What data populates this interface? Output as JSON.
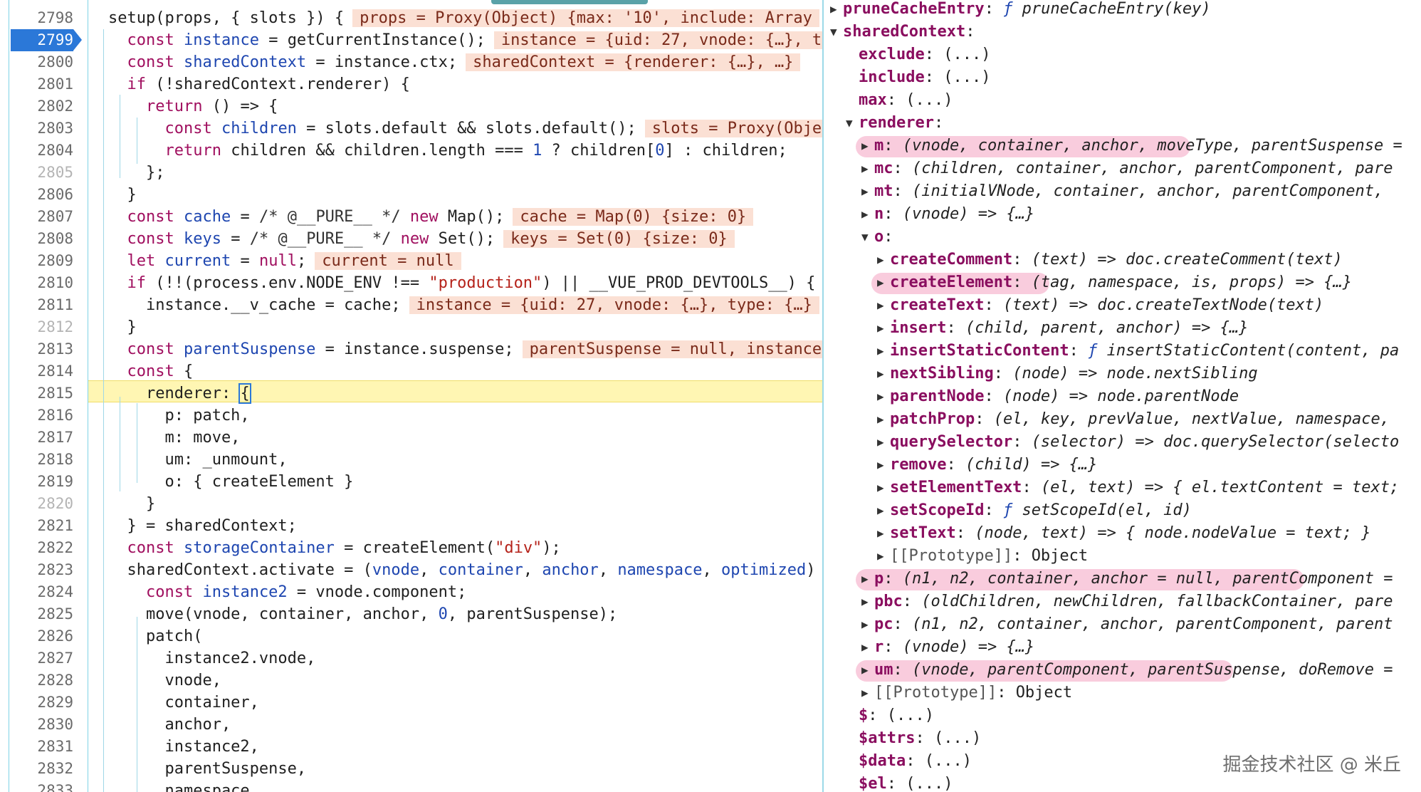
{
  "editor": {
    "lines": [
      {
        "no": "2798",
        "code": "setup(props, { slots }) {",
        "inline": "props = Proxy(Object) {max: '10', include: Array"
      },
      {
        "no": "2799",
        "code": "  const instance = getCurrentInstance();",
        "inline": "instance = {uid: 27, vnode: {…}, t"
      },
      {
        "no": "2800",
        "code": "  const sharedContext = instance.ctx;",
        "inline": "sharedContext = {renderer: {…}, …}"
      },
      {
        "no": "2801",
        "code": "  if (!sharedContext.renderer) {",
        "inline": ""
      },
      {
        "no": "2802",
        "code": "    return () => {",
        "inline": ""
      },
      {
        "no": "2803",
        "code": "      const children = slots.default && slots.default();",
        "inline": "slots = Proxy(Obje"
      },
      {
        "no": "2804",
        "code": "      return children && children.length === 1 ? children[0] : children;",
        "inline": ""
      },
      {
        "no": "2805",
        "code": "    };",
        "inline": ""
      },
      {
        "no": "2806",
        "code": "  }",
        "inline": ""
      },
      {
        "no": "2807",
        "code": "  const cache = /* @__PURE__ */ new Map();",
        "inline": "cache = Map(0) {size: 0}"
      },
      {
        "no": "2808",
        "code": "  const keys = /* @__PURE__ */ new Set();",
        "inline": "keys = Set(0) {size: 0}"
      },
      {
        "no": "2809",
        "code": "  let current = null;",
        "inline": "current = null"
      },
      {
        "no": "2810",
        "code": "  if (!!(process.env.NODE_ENV !== \"production\") || __VUE_PROD_DEVTOOLS__) {",
        "inline": ""
      },
      {
        "no": "2811",
        "code": "    instance.__v_cache = cache;",
        "inline": "instance = {uid: 27, vnode: {…}, type: {…}"
      },
      {
        "no": "2812",
        "code": "  }",
        "inline": ""
      },
      {
        "no": "2813",
        "code": "  const parentSuspense = instance.suspense;",
        "inline": "parentSuspense = null, instance"
      },
      {
        "no": "2814",
        "code": "  const {",
        "inline": ""
      },
      {
        "no": "2815",
        "code": "    renderer: {",
        "inline": ""
      },
      {
        "no": "2816",
        "code": "      p: patch,",
        "inline": ""
      },
      {
        "no": "2817",
        "code": "      m: move,",
        "inline": ""
      },
      {
        "no": "2818",
        "code": "      um: _unmount,",
        "inline": ""
      },
      {
        "no": "2819",
        "code": "      o: { createElement }",
        "inline": ""
      },
      {
        "no": "2820",
        "code": "    }",
        "inline": ""
      },
      {
        "no": "2821",
        "code": "  } = sharedContext;",
        "inline": ""
      },
      {
        "no": "2822",
        "code": "  const storageContainer = createElement(\"div\");",
        "inline": ""
      },
      {
        "no": "2823",
        "code": "  sharedContext.activate = (vnode, container, anchor, namespace, optimized)",
        "inline": ""
      },
      {
        "no": "2824",
        "code": "    const instance2 = vnode.component;",
        "inline": ""
      },
      {
        "no": "2825",
        "code": "    move(vnode, container, anchor, 0, parentSuspense);",
        "inline": ""
      },
      {
        "no": "2826",
        "code": "    patch(",
        "inline": ""
      },
      {
        "no": "2827",
        "code": "      instance2.vnode,",
        "inline": ""
      },
      {
        "no": "2828",
        "code": "      vnode,",
        "inline": ""
      },
      {
        "no": "2829",
        "code": "      container,",
        "inline": ""
      },
      {
        "no": "2830",
        "code": "      anchor,",
        "inline": ""
      },
      {
        "no": "2831",
        "code": "      instance2,",
        "inline": ""
      },
      {
        "no": "2832",
        "code": "      parentSuspense,",
        "inline": ""
      },
      {
        "no": "2833",
        "code": "      namespace,",
        "inline": ""
      }
    ],
    "breakpoint_line": "2799",
    "current_line": "2815"
  },
  "scope": {
    "rows": [
      {
        "indent": 0,
        "tri": "▶",
        "key": "pruneCacheEntry",
        "val": "ƒ pruneCacheEntry(key)",
        "kind": "fn"
      },
      {
        "indent": 0,
        "tri": "▼",
        "key": "sharedContext",
        "val": "",
        "kind": "plain"
      },
      {
        "indent": 1,
        "tri": "",
        "key": "exclude",
        "val": "(...)",
        "kind": "plain"
      },
      {
        "indent": 1,
        "tri": "",
        "key": "include",
        "val": "(...)",
        "kind": "plain"
      },
      {
        "indent": 1,
        "tri": "",
        "key": "max",
        "val": "(...)",
        "kind": "plain"
      },
      {
        "indent": 1,
        "tri": "▼",
        "key": "renderer",
        "val": "",
        "kind": "plain"
      },
      {
        "indent": 2,
        "tri": "▶",
        "key": "m",
        "val": "(vnode, container, anchor, moveType, parentSuspense =",
        "kind": "it"
      },
      {
        "indent": 2,
        "tri": "▶",
        "key": "mc",
        "val": "(children, container, anchor, parentComponent, pare",
        "kind": "it"
      },
      {
        "indent": 2,
        "tri": "▶",
        "key": "mt",
        "val": "(initialVNode, container, anchor, parentComponent, ",
        "kind": "it"
      },
      {
        "indent": 2,
        "tri": "▶",
        "key": "n",
        "val": "(vnode) => {…}",
        "kind": "it"
      },
      {
        "indent": 2,
        "tri": "▼",
        "key": "o",
        "val": "",
        "kind": "plain"
      },
      {
        "indent": 3,
        "tri": "▶",
        "key": "createComment",
        "val": "(text) => doc.createComment(text)",
        "kind": "it"
      },
      {
        "indent": 3,
        "tri": "▶",
        "key": "createElement",
        "val": "(tag, namespace, is, props) => {…}",
        "kind": "it"
      },
      {
        "indent": 3,
        "tri": "▶",
        "key": "createText",
        "val": "(text) => doc.createTextNode(text)",
        "kind": "it"
      },
      {
        "indent": 3,
        "tri": "▶",
        "key": "insert",
        "val": "(child, parent, anchor) => {…}",
        "kind": "it"
      },
      {
        "indent": 3,
        "tri": "▶",
        "key": "insertStaticContent",
        "val": "ƒ insertStaticContent(content, pa",
        "kind": "fn"
      },
      {
        "indent": 3,
        "tri": "▶",
        "key": "nextSibling",
        "val": "(node) => node.nextSibling",
        "kind": "it"
      },
      {
        "indent": 3,
        "tri": "▶",
        "key": "parentNode",
        "val": "(node) => node.parentNode",
        "kind": "it"
      },
      {
        "indent": 3,
        "tri": "▶",
        "key": "patchProp",
        "val": "(el, key, prevValue, nextValue, namespace, ",
        "kind": "it"
      },
      {
        "indent": 3,
        "tri": "▶",
        "key": "querySelector",
        "val": "(selector) => doc.querySelector(selecto",
        "kind": "it"
      },
      {
        "indent": 3,
        "tri": "▶",
        "key": "remove",
        "val": "(child) => {…}",
        "kind": "it"
      },
      {
        "indent": 3,
        "tri": "▶",
        "key": "setElementText",
        "val": "(el, text) => { el.textContent = text;",
        "kind": "it"
      },
      {
        "indent": 3,
        "tri": "▶",
        "key": "setScopeId",
        "val": "ƒ setScopeId(el, id)",
        "kind": "fn"
      },
      {
        "indent": 3,
        "tri": "▶",
        "key": "setText",
        "val": "(node, text) => { node.nodeValue = text; }",
        "kind": "it"
      },
      {
        "indent": 3,
        "tri": "▶",
        "key": "[[Prototype]]",
        "val": "Object",
        "kind": "proto"
      },
      {
        "indent": 2,
        "tri": "▶",
        "key": "p",
        "val": "(n1, n2, container, anchor = null, parentComponent =",
        "kind": "it"
      },
      {
        "indent": 2,
        "tri": "▶",
        "key": "pbc",
        "val": "(oldChildren, newChildren, fallbackContainer, pare",
        "kind": "it"
      },
      {
        "indent": 2,
        "tri": "▶",
        "key": "pc",
        "val": "(n1, n2, container, anchor, parentComponent, parent",
        "kind": "it"
      },
      {
        "indent": 2,
        "tri": "▶",
        "key": "r",
        "val": "(vnode) => {…}",
        "kind": "it"
      },
      {
        "indent": 2,
        "tri": "▶",
        "key": "um",
        "val": "(vnode, parentComponent, parentSuspense, doRemove =",
        "kind": "it"
      },
      {
        "indent": 2,
        "tri": "▶",
        "key": "[[Prototype]]",
        "val": "Object",
        "kind": "proto"
      },
      {
        "indent": 1,
        "tri": "",
        "key": "$",
        "val": "(...)",
        "kind": "plain"
      },
      {
        "indent": 1,
        "tri": "",
        "key": "$attrs",
        "val": "(...)",
        "kind": "plain"
      },
      {
        "indent": 1,
        "tri": "",
        "key": "$data",
        "val": "(...)",
        "kind": "plain"
      },
      {
        "indent": 1,
        "tri": "",
        "key": "$el",
        "val": "(...)",
        "kind": "plain"
      }
    ],
    "highlighted_keys": [
      "m",
      "createElement",
      "p",
      "um"
    ]
  },
  "watermark": "掘金技术社区 @ 米丘"
}
